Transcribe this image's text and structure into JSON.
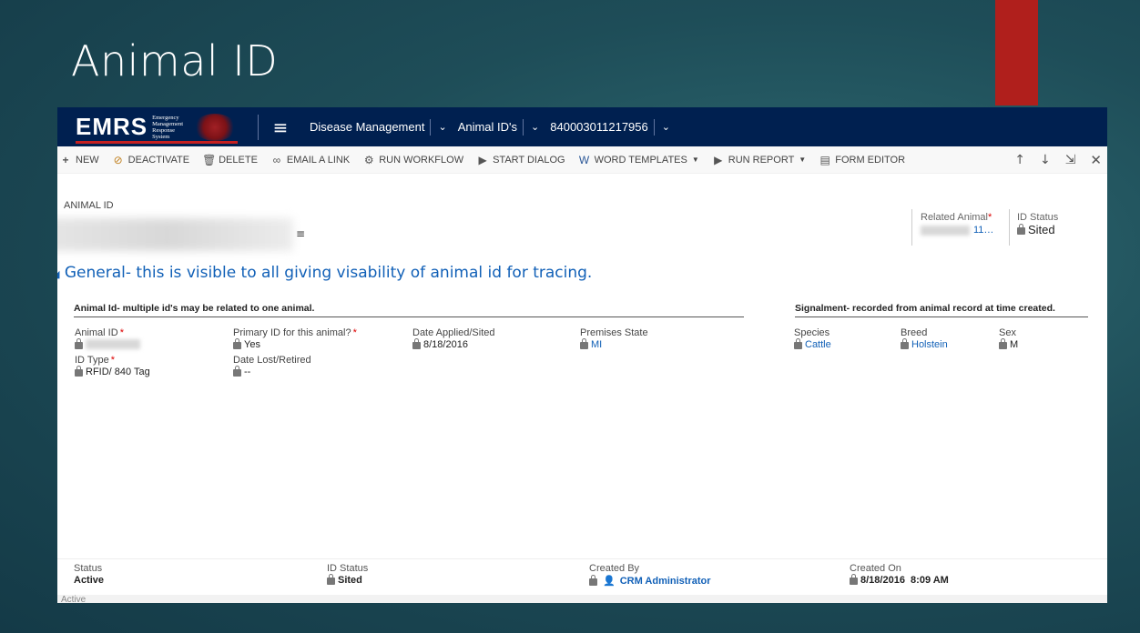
{
  "slide": {
    "title": "Animal ID"
  },
  "nav": {
    "logo_text": "EMRS",
    "logo_sub": [
      "Emergency",
      "Management",
      "Response",
      "System"
    ],
    "items": [
      "Disease Management",
      "Animal ID's",
      "840003011217956"
    ]
  },
  "toolbar": {
    "new": "NEW",
    "deactivate": "DEACTIVATE",
    "delete": "DELETE",
    "email_link": "EMAIL A LINK",
    "run_workflow": "RUN WORKFLOW",
    "start_dialog": "START DIALOG",
    "word_templates": "WORD TEMPLATES",
    "run_report": "RUN REPORT",
    "form_editor": "FORM EDITOR"
  },
  "header": {
    "entity_label": "ANIMAL ID",
    "related_animal_label": "Related Animal",
    "related_animal_value": "11…",
    "id_status_label": "ID Status",
    "id_status_value": "Sited"
  },
  "section": {
    "title": "General- this is visible to all giving visability of animal id for tracing."
  },
  "groups": {
    "animal_id": "Animal Id- multiple id's may be related to one animal.",
    "signalment": "Signalment- recorded from animal record at time created."
  },
  "fields": {
    "animal_id_label": "Animal ID",
    "id_type_label": "ID Type",
    "id_type_value": "RFID/ 840 Tag",
    "primary_id_label": "Primary ID for this animal?",
    "primary_id_value": "Yes",
    "date_lost_label": "Date Lost/Retired",
    "date_lost_value": "--",
    "date_applied_label": "Date Applied/Sited",
    "date_applied_value": "8/18/2016",
    "premises_state_label": "Premises State",
    "premises_state_value": "MI",
    "species_label": "Species",
    "species_value": "Cattle",
    "breed_label": "Breed",
    "breed_value": "Holstein",
    "sex_label": "Sex",
    "sex_value": "M"
  },
  "footer": {
    "status_label": "Status",
    "status_value": "Active",
    "id_status_label": "ID Status",
    "id_status_value": "Sited",
    "created_by_label": "Created By",
    "created_by_value": "CRM Administrator",
    "created_on_label": "Created On",
    "created_on_value": "8/18/2016  8:09 AM",
    "statusbar": "Active"
  },
  "colors": {
    "nav_bg": "#002050",
    "link": "#1160b7",
    "accent_red": "#b01f1c",
    "required": "#dd0000"
  }
}
